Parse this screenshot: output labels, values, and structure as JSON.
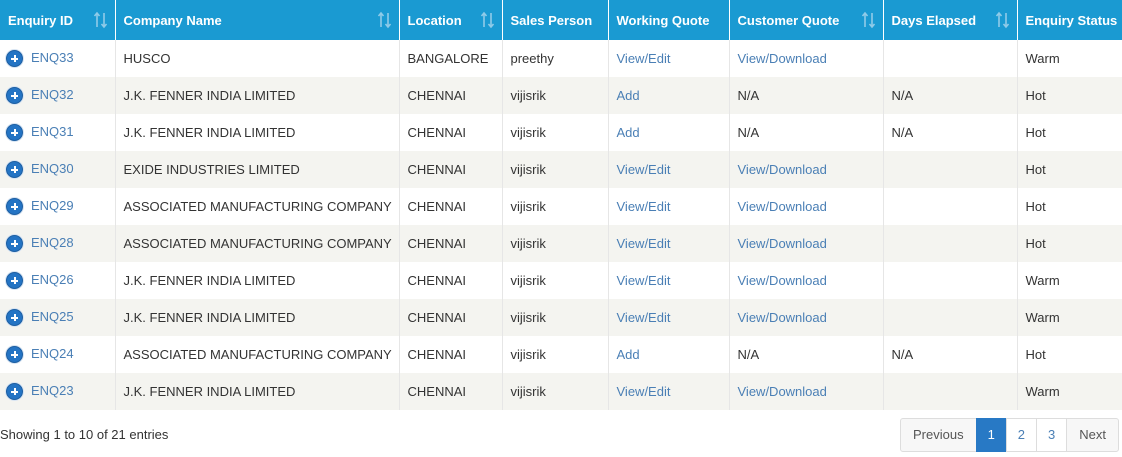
{
  "table": {
    "headers": [
      {
        "label": "Enquiry ID",
        "sortable": true
      },
      {
        "label": "Company Name",
        "sortable": true
      },
      {
        "label": "Location",
        "sortable": true
      },
      {
        "label": "Sales Person",
        "sortable": false
      },
      {
        "label": "Working Quote",
        "sortable": false
      },
      {
        "label": "Customer Quote",
        "sortable": true
      },
      {
        "label": "Days Elapsed",
        "sortable": true
      },
      {
        "label": "Enquiry Status",
        "sortable": false
      }
    ],
    "rows": [
      {
        "id": "ENQ33",
        "company": "HUSCO",
        "location": "BANGALORE",
        "sales": "preethy",
        "working": "View/Edit",
        "working_link": true,
        "customer": "View/Download",
        "customer_link": true,
        "days": "",
        "status": "Warm"
      },
      {
        "id": "ENQ32",
        "company": "J.K. FENNER INDIA LIMITED",
        "location": "CHENNAI",
        "sales": "vijisrik",
        "working": "Add",
        "working_link": true,
        "customer": "N/A",
        "customer_link": false,
        "days": "N/A",
        "status": "Hot"
      },
      {
        "id": "ENQ31",
        "company": "J.K. FENNER INDIA LIMITED",
        "location": "CHENNAI",
        "sales": "vijisrik",
        "working": "Add",
        "working_link": true,
        "customer": "N/A",
        "customer_link": false,
        "days": "N/A",
        "status": "Hot"
      },
      {
        "id": "ENQ30",
        "company": "EXIDE INDUSTRIES LIMITED",
        "location": "CHENNAI",
        "sales": "vijisrik",
        "working": "View/Edit",
        "working_link": true,
        "customer": "View/Download",
        "customer_link": true,
        "days": "",
        "status": "Hot"
      },
      {
        "id": "ENQ29",
        "company": "ASSOCIATED MANUFACTURING COMPANY",
        "location": "CHENNAI",
        "sales": "vijisrik",
        "working": "View/Edit",
        "working_link": true,
        "customer": "View/Download",
        "customer_link": true,
        "days": "",
        "status": "Hot"
      },
      {
        "id": "ENQ28",
        "company": "ASSOCIATED MANUFACTURING COMPANY",
        "location": "CHENNAI",
        "sales": "vijisrik",
        "working": "View/Edit",
        "working_link": true,
        "customer": "View/Download",
        "customer_link": true,
        "days": "",
        "status": "Hot"
      },
      {
        "id": "ENQ26",
        "company": "J.K. FENNER INDIA LIMITED",
        "location": "CHENNAI",
        "sales": "vijisrik",
        "working": "View/Edit",
        "working_link": true,
        "customer": "View/Download",
        "customer_link": true,
        "days": "",
        "status": "Warm"
      },
      {
        "id": "ENQ25",
        "company": "J.K. FENNER INDIA LIMITED",
        "location": "CHENNAI",
        "sales": "vijisrik",
        "working": "View/Edit",
        "working_link": true,
        "customer": "View/Download",
        "customer_link": true,
        "days": "",
        "status": "Warm"
      },
      {
        "id": "ENQ24",
        "company": "ASSOCIATED MANUFACTURING COMPANY",
        "location": "CHENNAI",
        "sales": "vijisrik",
        "working": "Add",
        "working_link": true,
        "customer": "N/A",
        "customer_link": false,
        "days": "N/A",
        "status": "Hot"
      },
      {
        "id": "ENQ23",
        "company": "J.K. FENNER INDIA LIMITED",
        "location": "CHENNAI",
        "sales": "vijisrik",
        "working": "View/Edit",
        "working_link": true,
        "customer": "View/Download",
        "customer_link": true,
        "days": "",
        "status": "Warm"
      }
    ]
  },
  "footer": {
    "info": "Showing 1 to 10 of 21 entries",
    "pagination": {
      "previous": "Previous",
      "pages": [
        "1",
        "2",
        "3"
      ],
      "active_page": "1",
      "next": "Next"
    }
  },
  "icons": {
    "sort": "sort-icon",
    "expand": "expand-row-icon"
  },
  "colors": {
    "header_bg": "#1a9ad2",
    "link": "#4a7fb5",
    "expand_icon": "#2474c4",
    "row_stripe": "#f4f4f0",
    "active_page": "#2879c5"
  }
}
